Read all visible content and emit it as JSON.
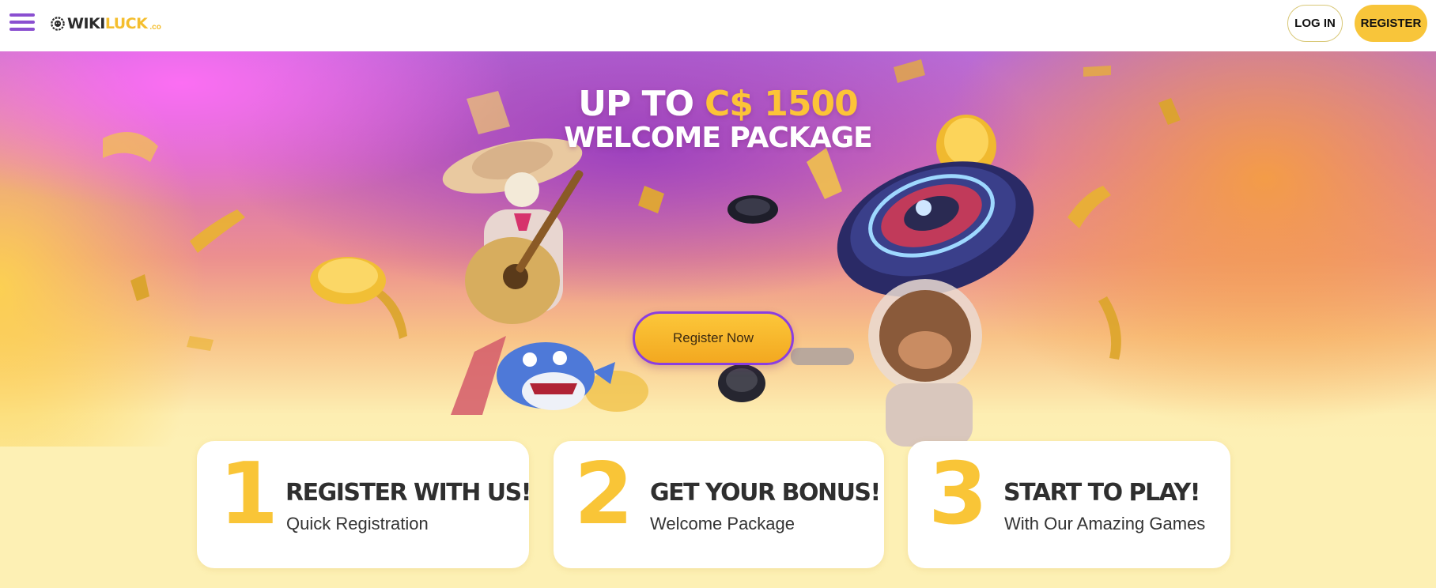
{
  "header": {
    "logo": {
      "wiki": "WIKI",
      "luck": "LUCK",
      "co": ".co"
    },
    "login_label": "LOG IN",
    "register_label": "REGISTER"
  },
  "hero": {
    "line1_prefix": "UP TO",
    "line1_amount": "C$ 1500",
    "line2": "WELCOME PACKAGE",
    "cta_label": "Register Now"
  },
  "steps": [
    {
      "number": "1",
      "title": "REGISTER WITH US!",
      "subtitle": "Quick Registration"
    },
    {
      "number": "2",
      "title": "GET YOUR BONUS!",
      "subtitle": "Welcome Package"
    },
    {
      "number": "3",
      "title": "START TO PLAY!",
      "subtitle": "With Our Amazing Games"
    }
  ],
  "colors": {
    "accent_yellow": "#f9c537",
    "accent_purple": "#8a4fd0",
    "text_dark": "#2f2f2f"
  },
  "icons": [
    "hamburger-menu-icon",
    "lion-logo-icon"
  ]
}
